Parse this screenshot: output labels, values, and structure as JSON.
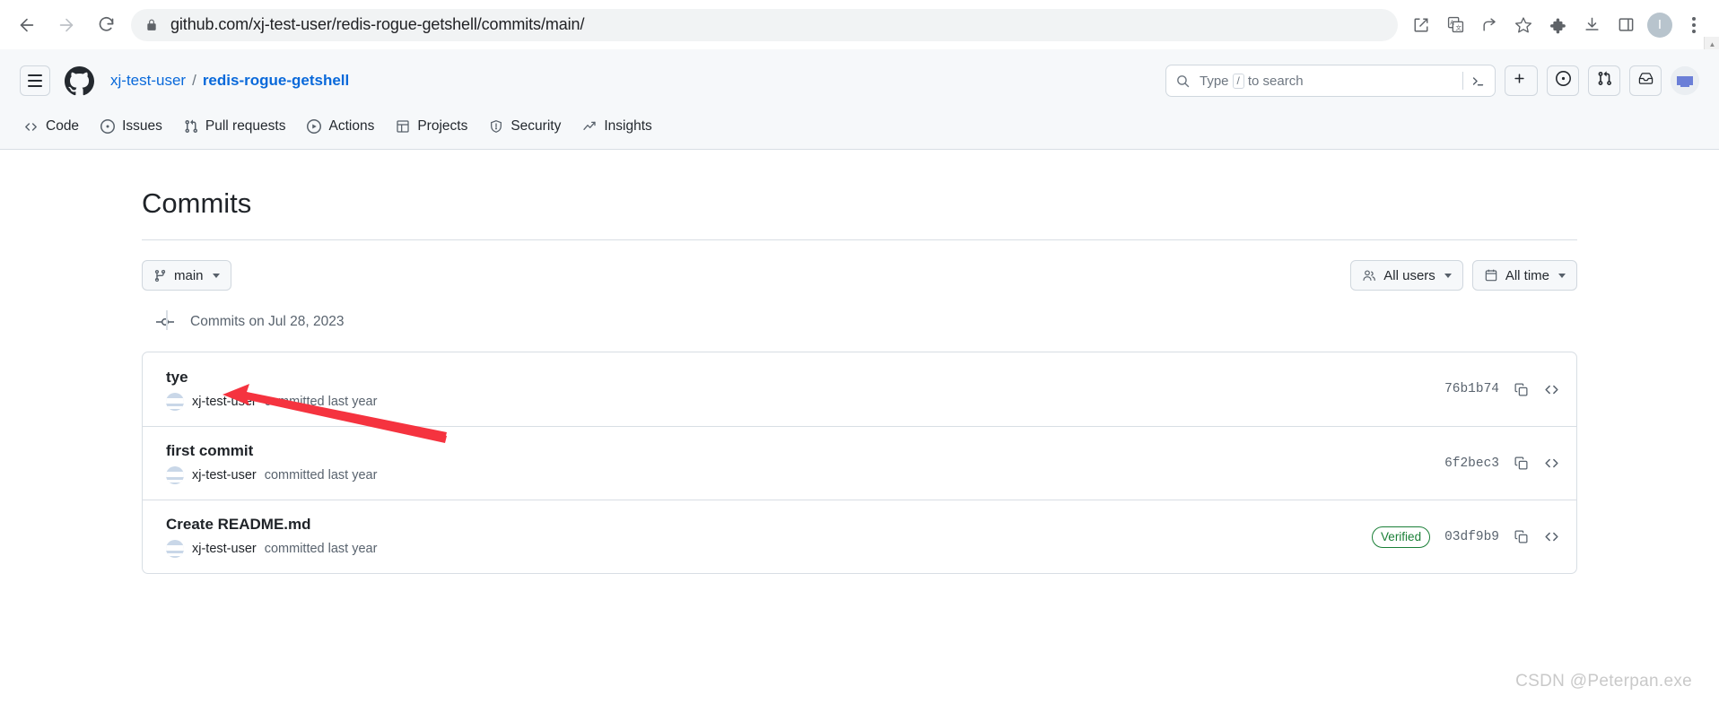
{
  "browser": {
    "url": "github.com/xj-test-user/redis-rogue-getshell/commits/main/",
    "back_icon": "back-arrow-icon",
    "forward_icon": "forward-arrow-icon",
    "reload_icon": "reload-icon",
    "lock_icon": "lock-icon",
    "toolbar_icons": [
      "open-in-new-icon",
      "translate-icon",
      "share-icon",
      "bookmark-star-icon",
      "extensions-puzzle-icon",
      "downloads-icon",
      "side-panel-icon"
    ],
    "profile_initial": "I",
    "menu_icon": "kebab-menu-icon"
  },
  "gh_header": {
    "hamburger_icon": "hamburger-menu-icon",
    "logo_icon": "github-logo-icon",
    "breadcrumb": {
      "owner": "xj-test-user",
      "separator": "/",
      "repo": "redis-rogue-getshell"
    },
    "search": {
      "placeholder_prefix": "Type",
      "placeholder_key": "/",
      "placeholder_suffix": "to search",
      "search_icon": "search-icon",
      "command_palette_icon": "command-palette-icon"
    },
    "actions": [
      {
        "name": "create-new-button",
        "icon": "plus-icon",
        "has_caret": true
      },
      {
        "name": "issues-button",
        "icon": "issue-opened-icon",
        "has_caret": false
      },
      {
        "name": "pull-requests-button",
        "icon": "git-pull-request-icon",
        "has_caret": false
      },
      {
        "name": "notifications-button",
        "icon": "inbox-icon",
        "has_caret": false
      }
    ],
    "avatar_name": "user-avatar"
  },
  "repo_nav": [
    {
      "label": "Code",
      "icon": "code-icon"
    },
    {
      "label": "Issues",
      "icon": "issue-opened-icon"
    },
    {
      "label": "Pull requests",
      "icon": "git-pull-request-icon"
    },
    {
      "label": "Actions",
      "icon": "play-icon"
    },
    {
      "label": "Projects",
      "icon": "table-icon"
    },
    {
      "label": "Security",
      "icon": "shield-icon"
    },
    {
      "label": "Insights",
      "icon": "graph-icon"
    }
  ],
  "main": {
    "title": "Commits",
    "branch_button": {
      "label": "main",
      "icon": "git-branch-icon"
    },
    "filters": [
      {
        "label": "All users",
        "icon": "people-icon",
        "name": "all-users-filter"
      },
      {
        "label": "All time",
        "icon": "calendar-icon",
        "name": "all-time-filter"
      }
    ],
    "date_group": {
      "label": "Commits on Jul 28, 2023",
      "icon": "commit-node-icon"
    },
    "commits": [
      {
        "message": "tye",
        "author": "xj-test-user",
        "meta_suffix": "committed last year",
        "sha": "76b1b74",
        "verified": null
      },
      {
        "message": "first commit",
        "author": "xj-test-user",
        "meta_suffix": "committed last year",
        "sha": "6f2bec3",
        "verified": null
      },
      {
        "message": "Create README.md",
        "author": "xj-test-user",
        "meta_suffix": "committed last year",
        "sha": "03df9b9",
        "verified": "Verified"
      }
    ],
    "row_actions": {
      "copy_icon": "copy-sha-icon",
      "browse_icon": "browse-code-icon"
    }
  },
  "annotation": {
    "arrow_color": "#f5333f",
    "arrow_name": "red-pointer-arrow"
  },
  "watermark": "CSDN @Peterpan.exe",
  "colors": {
    "accent_link": "#0969da",
    "header_bg": "#f6f8fa",
    "border": "#d8dee4",
    "verified_green": "#1a7f37",
    "muted_text": "#59636e"
  }
}
